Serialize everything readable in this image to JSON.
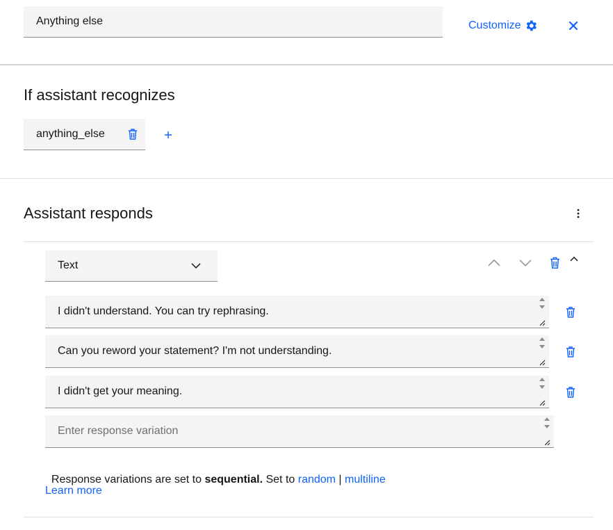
{
  "header": {
    "node_name": "Anything else",
    "customize_label": "Customize",
    "icons": {
      "customize": "gear-icon",
      "close": "close-icon"
    }
  },
  "recognizes": {
    "title": "If assistant recognizes",
    "condition": "anything_else",
    "icons": {
      "delete": "trash-icon",
      "add": "plus-icon"
    }
  },
  "responds": {
    "title": "Assistant responds",
    "response_type": "Text",
    "variations": [
      "I didn't understand. You can try rephrasing.",
      "Can you reword your statement? I'm not understanding.",
      "I didn't get your meaning."
    ],
    "new_variation_placeholder": "Enter response variation",
    "note": {
      "prefix": "Response variations are set to ",
      "mode": "sequential.",
      "set_to": " Set to ",
      "option_random": "random",
      "separator": " | ",
      "option_multiline": "multiline"
    },
    "learn_more": "Learn more"
  },
  "colors": {
    "accent": "#0f62fe",
    "field_bg": "#f4f4f4",
    "text": "#161616",
    "divider": "#e0e0e0"
  }
}
